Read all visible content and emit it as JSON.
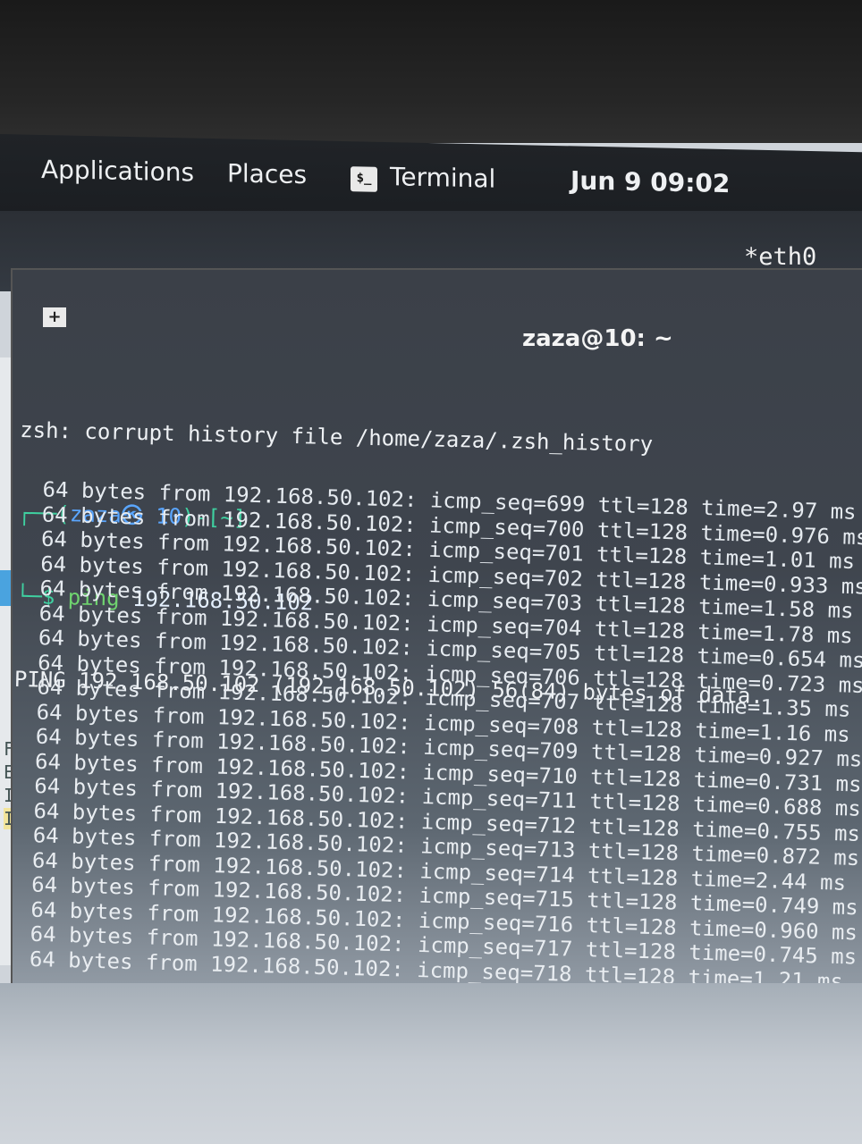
{
  "topbar": {
    "applications": "Applications",
    "places": "Places",
    "terminal": "Terminal",
    "terminal_icon": "$_",
    "clock": "Jun 9  09:02"
  },
  "network": {
    "interface": "*eth0"
  },
  "background_window": {
    "labels": [
      "Fr",
      "Et",
      "In",
      "In"
    ]
  },
  "terminal_window": {
    "title": "zaza@10: ~",
    "lines": {
      "warning": "zsh: corrupt history file /home/zaza/.zsh_history",
      "prompt_open": "┌──(",
      "prompt_user": "zaza㉿ 10",
      "prompt_close": ")-[~]",
      "prompt_cmd_prefix": "└─$ ",
      "command_name": "ping",
      "command_args": " 192.168.50.102",
      "ping_header": "PING 192.168.50.102 (192.168.50.102) 56(84) bytes of data."
    },
    "replies": [
      "64 bytes from 192.168.50.102: icmp_seq=699 ttl=128 time=2.97 ms",
      "64 bytes from 192.168.50.102: icmp_seq=700 ttl=128 time=0.976 ms",
      "64 bytes from 192.168.50.102: icmp_seq=701 ttl=128 time=1.01 ms",
      "64 bytes from 192.168.50.102: icmp_seq=702 ttl=128 time=0.933 ms",
      "64 bytes from 192.168.50.102: icmp_seq=703 ttl=128 time=1.58 ms",
      "64 bytes from 192.168.50.102: icmp_seq=704 ttl=128 time=1.78 ms",
      "64 bytes from 192.168.50.102: icmp_seq=705 ttl=128 time=0.654 ms",
      "64 bytes from 192.168.50.102: icmp_seq=706 ttl=128 time=0.723 ms",
      "64 bytes from 192.168.50.102: icmp_seq=707 ttl=128 time=1.35 ms",
      "64 bytes from 192.168.50.102: icmp_seq=708 ttl=128 time=1.16 ms",
      "64 bytes from 192.168.50.102: icmp_seq=709 ttl=128 time=0.927 ms",
      "64 bytes from 192.168.50.102: icmp_seq=710 ttl=128 time=0.731 ms",
      "64 bytes from 192.168.50.102: icmp_seq=711 ttl=128 time=0.688 ms",
      "64 bytes from 192.168.50.102: icmp_seq=712 ttl=128 time=0.755 ms",
      "64 bytes from 192.168.50.102: icmp_seq=713 ttl=128 time=0.872 ms",
      "64 bytes from 192.168.50.102: icmp_seq=714 ttl=128 time=2.44 ms",
      "64 bytes from 192.168.50.102: icmp_seq=715 ttl=128 time=0.749 ms",
      "64 bytes from 192.168.50.102: icmp_seq=716 ttl=128 time=0.960 ms",
      "64 bytes from 192.168.50.102: icmp_seq=717 ttl=128 time=0.745 ms",
      "64 bytes from 192.168.50.102: icmp_seq=718 ttl=128 time=1.21 ms"
    ]
  }
}
